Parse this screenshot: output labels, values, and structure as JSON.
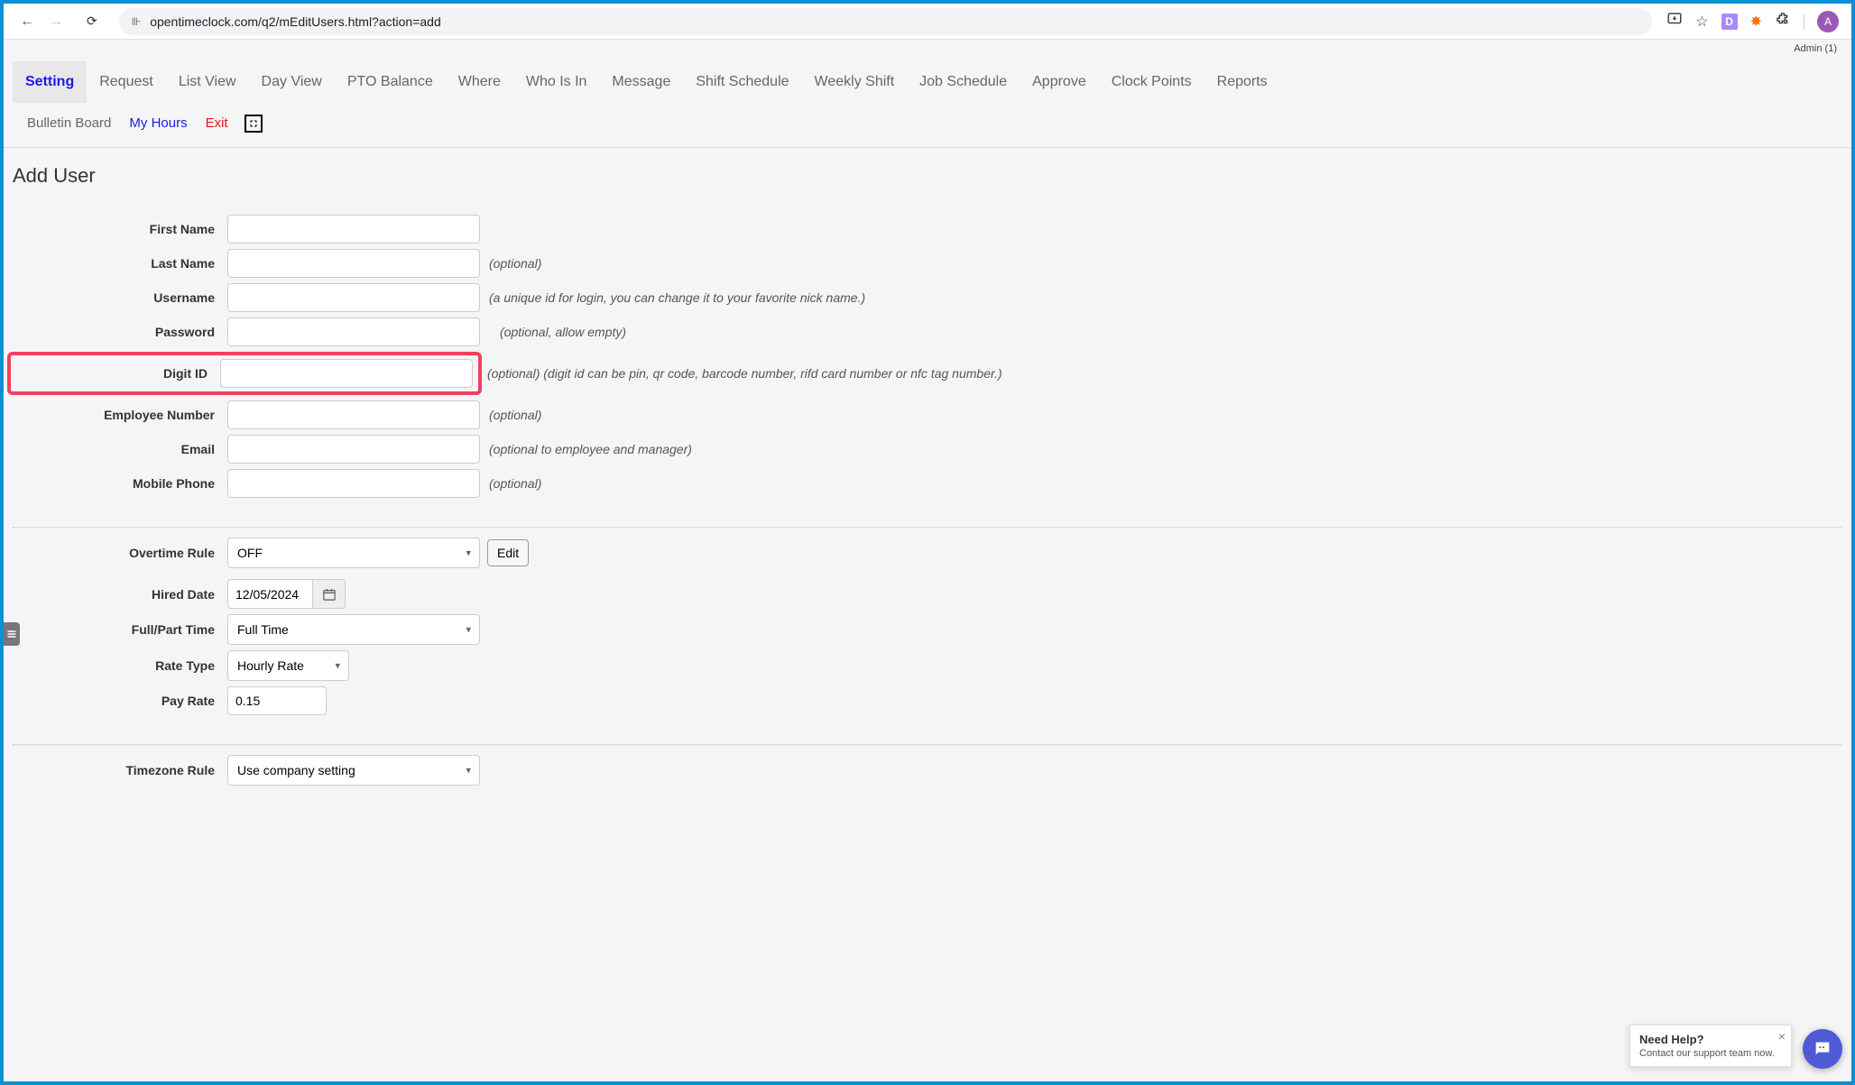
{
  "browser": {
    "url": "opentimeclock.com/q2/mEditUsers.html?action=add"
  },
  "header": {
    "admin_label": "Admin (1)"
  },
  "nav": {
    "tabs": [
      {
        "label": "Setting",
        "active": true
      },
      {
        "label": "Request"
      },
      {
        "label": "List View"
      },
      {
        "label": "Day View"
      },
      {
        "label": "PTO Balance"
      },
      {
        "label": "Where"
      },
      {
        "label": "Who Is In"
      },
      {
        "label": "Message"
      },
      {
        "label": "Shift Schedule"
      },
      {
        "label": "Weekly Shift"
      },
      {
        "label": "Job Schedule"
      },
      {
        "label": "Approve"
      },
      {
        "label": "Clock Points"
      },
      {
        "label": "Reports"
      }
    ],
    "secondary": {
      "bulletin_board": "Bulletin Board",
      "my_hours": "My Hours",
      "exit": "Exit"
    }
  },
  "page": {
    "title": "Add User"
  },
  "form": {
    "first_name": {
      "label": "First Name"
    },
    "last_name": {
      "label": "Last Name",
      "hint": "(optional)"
    },
    "username": {
      "label": "Username",
      "hint": "(a unique id for login, you can change it to your favorite nick name.)"
    },
    "password": {
      "label": "Password",
      "hint": "(optional, allow empty)"
    },
    "digit_id": {
      "label": "Digit ID",
      "hint": "(optional) (digit id can be pin, qr code, barcode number, rifd card number or nfc tag number.)"
    },
    "employee_number": {
      "label": "Employee Number",
      "hint": "(optional)"
    },
    "email": {
      "label": "Email",
      "hint": "(optional to employee and manager)"
    },
    "mobile_phone": {
      "label": "Mobile Phone",
      "hint": "(optional)"
    },
    "overtime_rule": {
      "label": "Overtime Rule",
      "value": "OFF",
      "edit_label": "Edit"
    },
    "hired_date": {
      "label": "Hired Date",
      "value": "12/05/2024"
    },
    "full_part_time": {
      "label": "Full/Part Time",
      "value": "Full Time"
    },
    "rate_type": {
      "label": "Rate Type",
      "value": "Hourly Rate"
    },
    "pay_rate": {
      "label": "Pay Rate",
      "value": "0.15"
    },
    "timezone_rule": {
      "label": "Timezone Rule",
      "value": "Use company setting"
    }
  },
  "help_widget": {
    "title": "Need Help?",
    "subtitle": "Contact our support team now."
  },
  "profile": {
    "initial": "A"
  },
  "ext": {
    "d_label": "D"
  }
}
